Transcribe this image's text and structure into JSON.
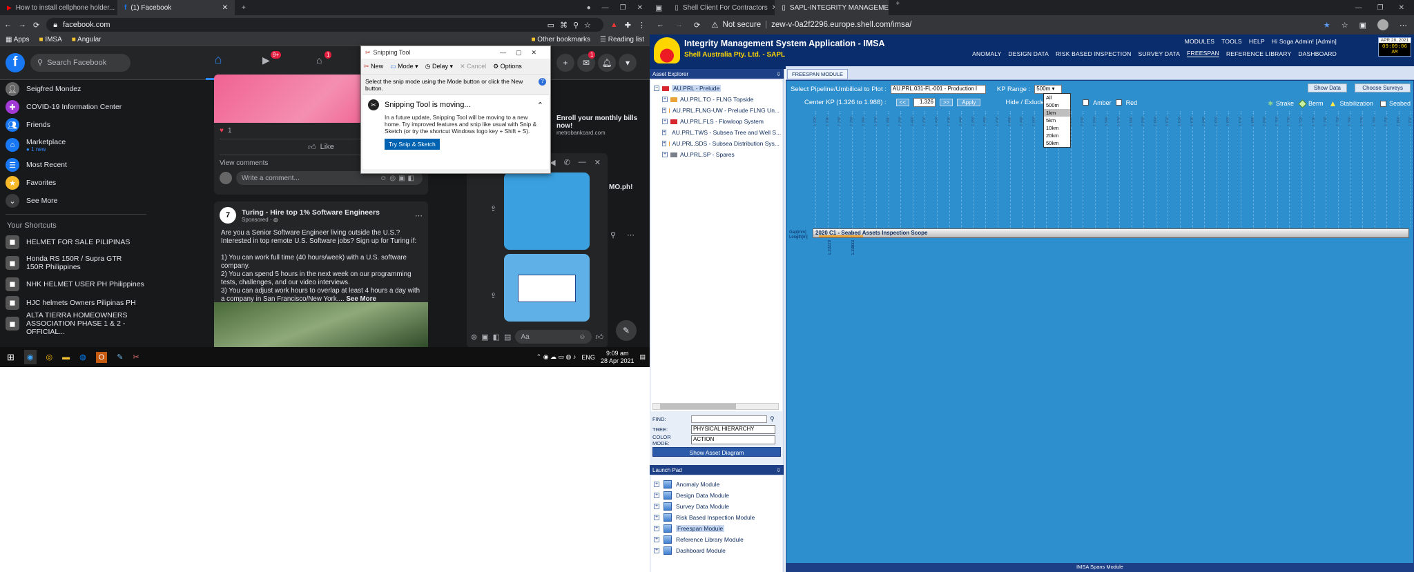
{
  "left_window": {
    "tabs": [
      {
        "label": "How to install cellphone holder..."
      },
      {
        "label": "(1) Facebook"
      }
    ],
    "new_tab": "+",
    "url": "facebook.com",
    "bookmarks": {
      "apps": "Apps",
      "items": [
        "IMSA",
        "Angular"
      ],
      "other": "Other bookmarks",
      "reading": "Reading list"
    },
    "fb": {
      "search_placeholder": "Search Facebook",
      "badges": {
        "watch": "9+",
        "market": "1",
        "messenger": "1"
      },
      "sidebar": [
        {
          "label": "Seigfred Mondez",
          "icon": "avatar"
        },
        {
          "label": "COVID-19 Information Center",
          "icon": "covid-icon"
        },
        {
          "label": "Friends",
          "icon": "friends-icon"
        },
        {
          "label": "Marketplace",
          "sub": "1 new",
          "icon": "marketplace-icon"
        },
        {
          "label": "Most Recent",
          "icon": "most-recent-icon"
        },
        {
          "label": "Favorites",
          "icon": "star-icon"
        },
        {
          "label": "See More",
          "icon": "chevron-down-icon"
        }
      ],
      "shortcuts_title": "Your Shortcuts",
      "shortcuts": [
        {
          "label": "HELMET FOR SALE PILIPINAS"
        },
        {
          "label": "Honda RS 150R / Supra GTR 150R Philippines"
        },
        {
          "label": "NHK HELMET USER PH Philippines"
        },
        {
          "label": "HJC helmets Owners Pilipinas PH"
        },
        {
          "label": "ALTA TIERRA HOMEOWNERS ASSOCIATION PHASE 1 & 2 - OFFICIAL..."
        }
      ],
      "post1": {
        "like_count": "1",
        "like": "Like",
        "view_comments": "View comments",
        "comment_placeholder": "Write a comment..."
      },
      "post2": {
        "author": "Turing - Hire top 1% Software Engineers",
        "meta": "Sponsored · ",
        "intro": "Are you a Senior Software Engineer living outside the U.S.? Interested in top remote U.S. Software jobs? Sign up for Turing if:",
        "p1": "1) You can work full time (40 hours/week) with a U.S. software company.",
        "p2": "2) You can spend 5 hours in the next week on our programming tests, challenges, and our video interviews.",
        "p3": "3) You can adjust work hours to overlap at least 4 hours a day with a company in San Francisco/New York....",
        "see_more": "See More"
      },
      "right_ad": {
        "title": "Enroll your monthly bills now!",
        "site": "metrobankcard.com"
      },
      "chat": {
        "partial_name": "MO.ph!",
        "input": "Aa"
      }
    },
    "snip": {
      "title": "Snipping Tool",
      "new": "New",
      "mode": "Mode",
      "delay": "Delay",
      "cancel": "Cancel",
      "options": "Options",
      "hint": "Select the snip mode using the Mode button or click the New button.",
      "moving_title": "Snipping Tool is moving...",
      "moving_body": "In a future update, Snipping Tool will be moving to a new home. Try improved features and snip like usual with Snip & Sketch (or try the shortcut Windows logo key + Shift + S).",
      "try_button": "Try Snip & Sketch"
    },
    "taskbar": {
      "lang": "ENG",
      "time": "9:09 am",
      "date": "28 Apr 2021"
    }
  },
  "right_window": {
    "tabs": [
      {
        "label": "Shell Client For Contractors"
      },
      {
        "label": "SAPL-INTEGRITY MANAGEMENT..."
      }
    ],
    "not_secure": "Not secure",
    "url": "zew-v-0a2f2296.europe.shell.com/imsa/",
    "app_title": "Integrity Management System Application - IMSA",
    "company": "Shell Australia Pty. Ltd. - SAPL",
    "top_menu": [
      "Modules",
      "Tools",
      "Help",
      "Hi Soga Admin! [Admin]"
    ],
    "nav": [
      "Anomaly",
      "Design Data",
      "Risk Based Inspection",
      "Survey Data",
      "Freespan",
      "Reference Library",
      "Dashboard"
    ],
    "nav_active": "Freespan",
    "clock_date": "APR 28, 2021",
    "clock_time": "09:09:06 AM",
    "asset_explorer": {
      "title": "Asset Explorer",
      "root": "AU.PRL - Prelude",
      "items": [
        {
          "label": "AU.PRL.TO - FLNG Topside",
          "color": "#e8a33a"
        },
        {
          "label": "AU.PRL.FLNG-UW - Prelude FLNG Un...",
          "color": "#e8a33a"
        },
        {
          "label": "AU.PRL.FLS - Flowloop System",
          "color": "#d8262e"
        },
        {
          "label": "AU.PRL.TWS - Subsea Tree and Well S...",
          "color": "#e8a33a"
        },
        {
          "label": "AU.PRL.SDS - Subsea Distribution Sys...",
          "color": "#e8a33a"
        },
        {
          "label": "AU.PRL.SP - Spares",
          "color": "#7a7f8a"
        }
      ],
      "find_label": "FIND:",
      "tree_label": "TREE:",
      "tree_value": "PHYSICAL HIERARCHY",
      "color_mode_label": "COLOR MODE:",
      "color_mode_value": "ACTION",
      "diagram_button": "Show Asset Diagram"
    },
    "launch_pad": {
      "title": "Launch Pad",
      "items": [
        "Anomaly Module",
        "Design Data Module",
        "Survey Data Module",
        "Risk Based Inspection Module",
        "Freespan Module",
        "Reference Library Module",
        "Dashboard Module"
      ],
      "active": "Freespan Module"
    },
    "freespan": {
      "tab": "Freespan Module",
      "select_label": "Select Pipeline/Umbilical to Plot :",
      "select_value": "AU.PRL.031-FL-001 - Production I",
      "kp_label": "KP Range :",
      "kp_value": "500m",
      "kp_options": [
        "All",
        "500m",
        "1km",
        "5km",
        "10km",
        "20km",
        "50km"
      ],
      "kp_highlight": "1km",
      "show_data": "Show Data",
      "choose_surveys": "Choose Surveys",
      "center_label": "Center KP (1.326 to 1.988) :",
      "prev": "<<",
      "center_value": "1.326",
      "next": ">>",
      "apply": "Apply",
      "hide_label": "Hide / Exlude :",
      "amber": "Amber",
      "red": "Red",
      "legend": [
        "Strake",
        "Berm",
        "Stabilization",
        "Seabed"
      ],
      "gap_label": "Gap[mm]",
      "length_label": "Length[m]",
      "bar_label": "2020 C1 - Seabed Assets Inspection Scope",
      "kp_ticks": [
        "1.326",
        "1.336",
        "1.346",
        "1.356",
        "1.366",
        "1.376",
        "1.386",
        "1.396",
        "1.406",
        "1.416",
        "1.426",
        "1.436",
        "1.446",
        "1.456",
        "1.466",
        "1.476",
        "1.486",
        "1.496",
        "1.506",
        "1.516",
        "1.526",
        "1.536",
        "1.546",
        "1.556",
        "1.566",
        "1.576",
        "1.586",
        "1.596",
        "1.606",
        "1.616",
        "1.626",
        "1.636",
        "1.646",
        "1.656",
        "1.666",
        "1.676",
        "1.686",
        "1.696",
        "1.706",
        "1.716",
        "1.726",
        "1.736",
        "1.746",
        "1.756",
        "1.766",
        "1.776",
        "1.786",
        "1.796",
        "1.806",
        "1.816"
      ],
      "markers": [
        "1.33229",
        "1.33833"
      ],
      "footer": "IMSA Spans Module"
    }
  }
}
